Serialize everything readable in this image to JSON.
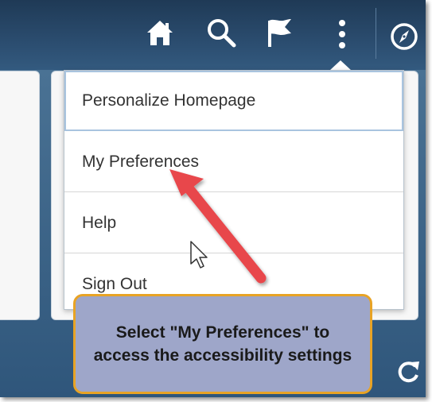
{
  "header": {
    "icons": [
      "home-icon",
      "search-icon",
      "flag-icon",
      "more-vertical-icon",
      "navbar-compass-icon"
    ]
  },
  "menu": {
    "items": [
      {
        "label": "Personalize Homepage"
      },
      {
        "label": "My Preferences"
      },
      {
        "label": "Help"
      },
      {
        "label": "Sign Out"
      }
    ]
  },
  "callout": {
    "text": "Select \"My Preferences\" to access the accessibility settings"
  },
  "colors": {
    "header": "#2a4b6d",
    "arrow": "#e8474c",
    "callout_fill": "#9ea6c9",
    "callout_border": "#e8a325"
  }
}
